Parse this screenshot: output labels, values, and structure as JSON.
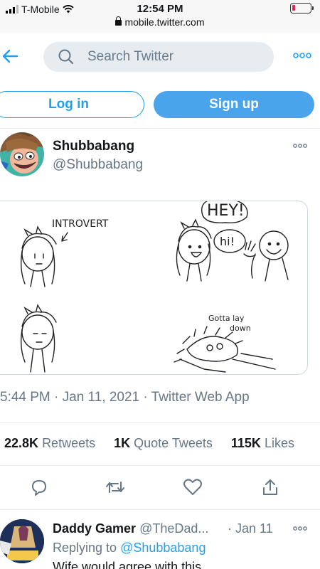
{
  "status_bar": {
    "carrier": "T-Mobile",
    "time": "12:54 PM",
    "url": "mobile.twitter.com"
  },
  "search": {
    "placeholder": "Search Twitter"
  },
  "auth": {
    "login_label": "Log in",
    "signup_label": "Sign up"
  },
  "tweet": {
    "author_name": "Shubbabang",
    "author_handle": "@Shubbabang",
    "comic_text": {
      "panel1": "INTROVERT",
      "panel2_a": "HEY!",
      "panel2_b": "hi!",
      "panel4_a": "Gotta lay",
      "panel4_b": "down"
    },
    "timestamp": "5:44 PM · Jan 11, 2021 · Twitter Web App",
    "retweets_count": "22.8K",
    "retweets_label": "Retweets",
    "quotes_count": "1K",
    "quotes_label": "Quote Tweets",
    "likes_count": "115K",
    "likes_label": "Likes"
  },
  "reply": {
    "author_name": "Daddy Gamer",
    "author_handle": "@TheDad...",
    "date": "· Jan 11",
    "replying_prefix": "Replying to",
    "replying_to": "@Shubbabang",
    "text": "Wife would agree with this"
  },
  "colors": {
    "brand_blue": "#1da1f2",
    "signup_blue": "#4aa4ec",
    "muted_gray": "#657786"
  }
}
